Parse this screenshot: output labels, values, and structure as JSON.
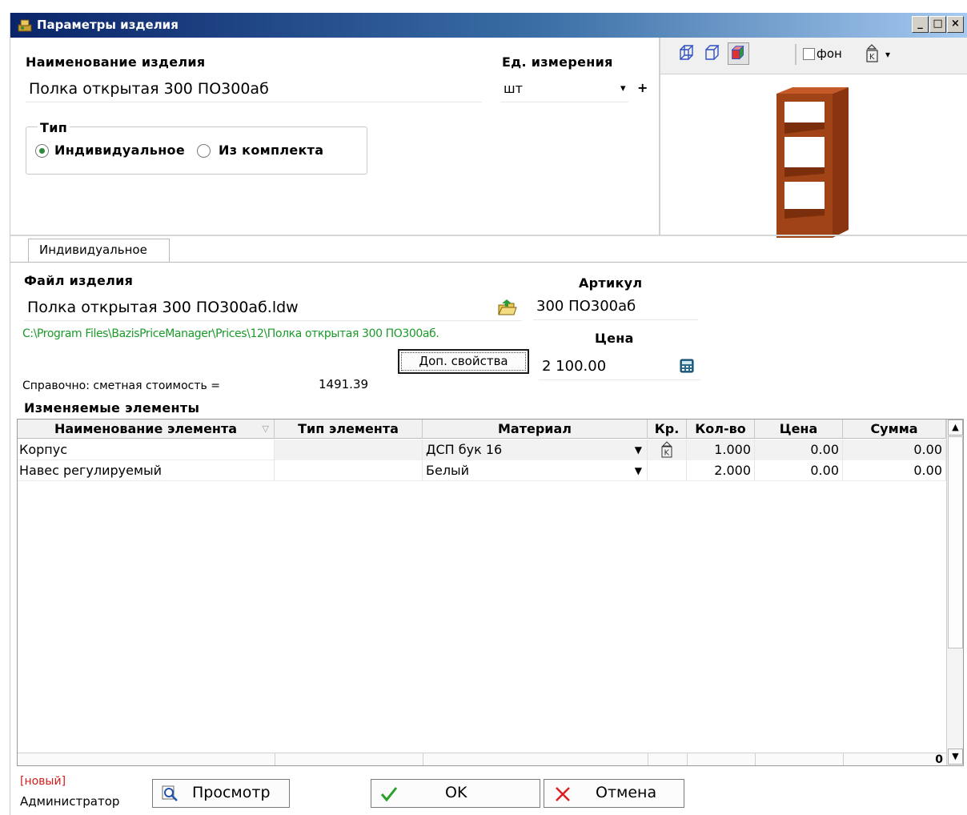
{
  "window": {
    "title": "Параметры изделия",
    "btn_min": "_",
    "btn_max": "□",
    "btn_close": "×"
  },
  "product": {
    "name_label": "Наименование изделия",
    "name_value": "Полка открытая 300 ПО300аб",
    "unit_label": "Ед. измерения",
    "unit_value": "шт",
    "unit_dropdown": "▾",
    "unit_add": "+"
  },
  "type_group": {
    "label": "Тип",
    "option1": "Индивидуальное",
    "option2": "Из комплекта",
    "selected": "Индивидуальное"
  },
  "preview": {
    "bg_checkbox_label": "фон",
    "bg_checked": false,
    "dropdown": "▾"
  },
  "tab": {
    "label": "Индивидуальное"
  },
  "file": {
    "label": "Файл изделия",
    "value": "Полка открытая 300 ПО300аб.ldw",
    "path": "C:\\Program Files\\BazisPriceManager\\Prices\\12\\Полка открытая 300 ПО300аб."
  },
  "article": {
    "label": "Артикул",
    "value": "300 ПО300аб"
  },
  "price": {
    "label": "Цена",
    "value": "2 100.00"
  },
  "extra_props_button": "Доп. свойства",
  "reference": {
    "label": "Справочно: сметная стоимость =",
    "value": "1491.39"
  },
  "elements": {
    "title": "Изменяемые элементы",
    "columns": [
      "Наименование элемента",
      "Тип элемента",
      "Материал",
      "Кр.",
      "Кол-во",
      "Цена",
      "Сумма"
    ],
    "rows": [
      {
        "name": "Корпус",
        "type": "",
        "material": "ДСП бук 16",
        "edge": "K",
        "qty": "1.000",
        "price": "0.00",
        "sum": "0.00"
      },
      {
        "name": "Навес регулируемый",
        "type": "",
        "material": "Белый",
        "edge": "",
        "qty": "2.000",
        "price": "0.00",
        "sum": "0.00"
      }
    ],
    "total": "0"
  },
  "status": {
    "state": "[новый]",
    "user": "Администратор"
  },
  "buttons": {
    "preview": "Просмотр",
    "ok": "OK",
    "cancel": "Отмена"
  },
  "colors": {
    "titlebar": "#0a246a",
    "path_text": "#1b9a2a",
    "state_text": "#d21c1c",
    "shelf_wood": "#a04418"
  }
}
